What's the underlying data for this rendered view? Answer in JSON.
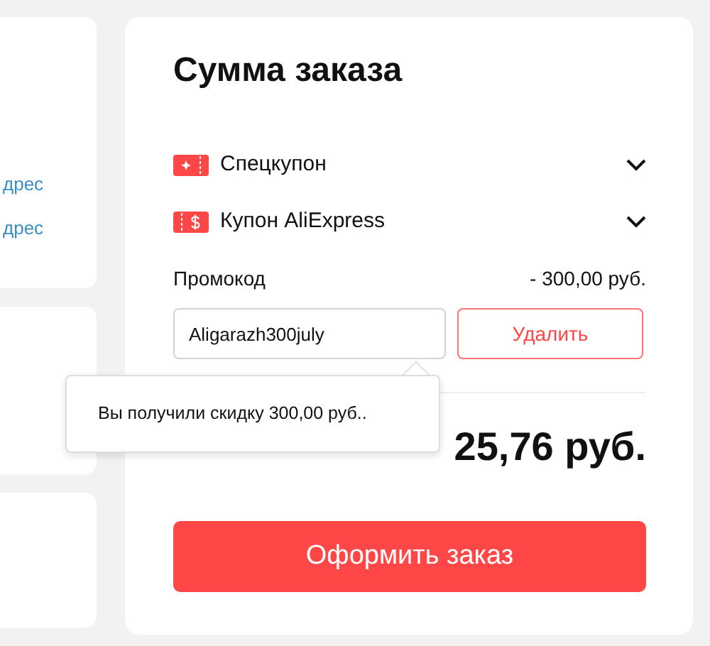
{
  "left_cards": [
    {
      "kind": "links",
      "links": [
        "дрес",
        "дрес"
      ]
    },
    {
      "kind": "blank"
    },
    {
      "kind": "blank"
    }
  ],
  "summary": {
    "title": "Сумма заказа",
    "coupons": [
      {
        "kind": "special",
        "label": "Спецкупон",
        "expanded": false
      },
      {
        "kind": "store",
        "label": "Купон AliExpress",
        "expanded": false
      }
    ],
    "promo": {
      "label": "Промокод",
      "discount": "- 300,00 руб.",
      "value": "Aligarazh300july",
      "remove_button": "Удалить"
    },
    "tooltip": "Вы получили скидку 300,00 руб..",
    "total": "25,76 руб.",
    "checkout_button": "Оформить заказ"
  }
}
